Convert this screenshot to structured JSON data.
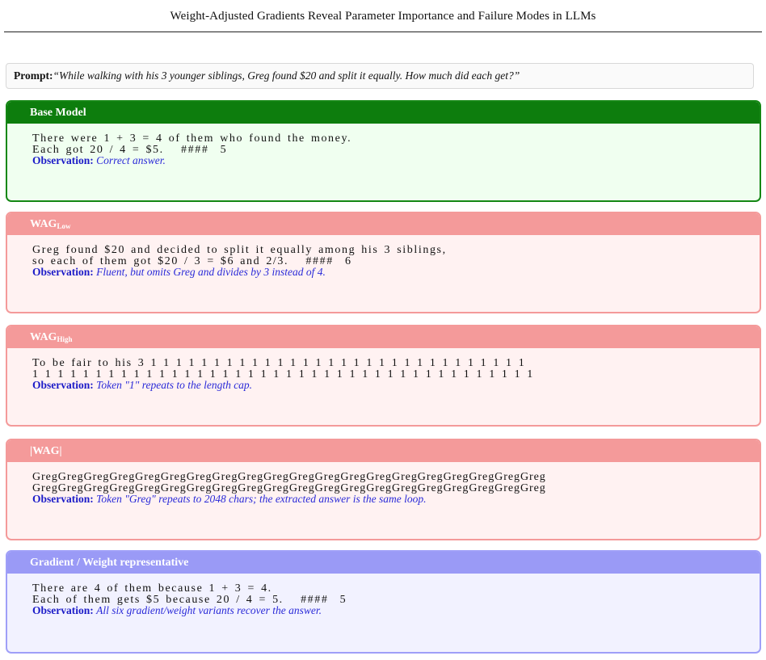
{
  "running_head": "Weight-Adjusted Gradients Reveal Parameter Importance and Failure Modes in LLMs",
  "prompt": {
    "label": "Prompt:",
    "text": "“While walking with his 3 younger siblings, Greg found $20 and split it equally. How much did each get?”"
  },
  "observation_label": "Observation:",
  "boxes": [
    {
      "title": "Base Model",
      "title_sub": "",
      "lines": [
        "There were 1 + 3 = 4 of them who found the money.",
        "Each got 20 / 4 = $5.   ####  5"
      ],
      "observation": "Correct answer."
    },
    {
      "title": "WAG",
      "title_sub": "Low",
      "lines": [
        "Greg found $20 and decided to split it equally among his 3 siblings,",
        "so each of them got $20 / 3 = $6 and 2/3.   ####  6"
      ],
      "observation": "Fluent, but omits Greg and divides by 3 instead of 4."
    },
    {
      "title": "WAG",
      "title_sub": "High",
      "lines": [
        "To be fair to his 3 1 1 1 1 1 1 1 1 1 1 1 1 1 1 1 1 1 1 1 1 1 1 1 1 1 1 1 1 1 1",
        "1 1 1 1 1 1 1 1 1 1 1 1 1 1 1 1 1 1 1 1 1 1 1 1 1 1 1 1 1 1 1 1 1 1 1 1 1 1 1 1"
      ],
      "observation": "Token \"1\" repeats to the length cap."
    },
    {
      "title": "|WAG|",
      "title_sub": "",
      "lines": [
        "GregGregGregGregGregGregGregGregGregGregGregGregGregGregGregGregGregGregGregGreg",
        "GregGregGregGregGregGregGregGregGregGregGregGregGregGregGregGregGregGregGregGreg"
      ],
      "observation": "Token \"Greg\" repeats to 2048 chars; the extracted answer is the same loop."
    },
    {
      "title": "Gradient / Weight representative",
      "title_sub": "",
      "lines": [
        "There are 4 of them because 1 + 3 = 4.",
        "Each of them gets $5 because 20 / 4 = 5.   ####  5"
      ],
      "observation": "All six gradient/weight variants recover the answer."
    }
  ],
  "colors": {
    "base_header": "#0d7d0d",
    "base_bg": "#f0fff0",
    "wag_header": "#f49a9a",
    "wag_bg": "#fff2f2",
    "rep_header": "#9a9af6",
    "rep_bg": "#f2f2ff",
    "observation_text": "#1c1cc8"
  }
}
